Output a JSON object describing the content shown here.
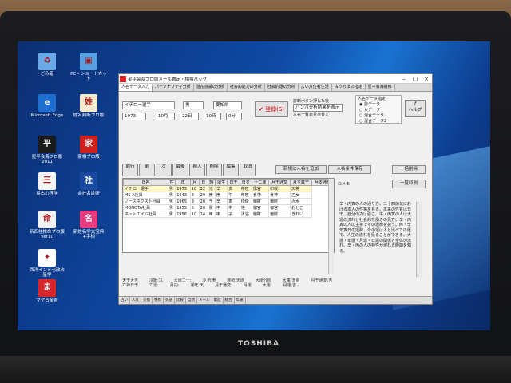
{
  "laptop": {
    "brand": "TOSHIBA"
  },
  "desktop_icons": [
    {
      "label": "ごみ箱",
      "icon": "recycle-bin-icon",
      "color": "#6aa8e8",
      "glyph": "♻"
    },
    {
      "label": "PC - ショートカット",
      "icon": "pc-icon",
      "color": "#5a9fe0",
      "glyph": "▣"
    },
    {
      "label": "Microsoft Edge",
      "icon": "edge-icon",
      "color": "#1f6fd0",
      "glyph": "e"
    },
    {
      "label": "姓名判断プロ版",
      "icon": "seimei-icon",
      "color": "#f5e9d0",
      "glyph": "姓"
    },
    {
      "label": "星平会海プロ版 2011",
      "icon": "hoshi-icon",
      "color": "#1a1a1a",
      "glyph": "平"
    },
    {
      "label": "家相プロ版",
      "icon": "kaso-icon",
      "color": "#d0201b",
      "glyph": "家"
    },
    {
      "label": "易占心理学",
      "icon": "ekisen-icon",
      "color": "#f4f4f4",
      "glyph": "三"
    },
    {
      "label": "会社名診断",
      "icon": "company-icon",
      "color": "#1a4aa0",
      "glyph": "社"
    },
    {
      "label": "新四柱推命プロ版 Ver10",
      "icon": "shichu-icon",
      "color": "#f2f2f2",
      "glyph": "命"
    },
    {
      "label": "新姓名学大宝典+手相",
      "icon": "tesou-icon",
      "color": "#e83a7e",
      "glyph": "名"
    },
    {
      "label": "西洋インド七政占星学",
      "icon": "seiyo-icon",
      "color": "#ffffff",
      "glyph": "✦"
    },
    {
      "label": "マヤ占星術",
      "icon": "maya-icon",
      "color": "#d6262c",
      "glyph": "ま"
    }
  ],
  "window": {
    "title": "星平会海プロ版メール鑑定・相場パック",
    "tabs": [
      "人名データ入力",
      "パーソナリティ分析",
      "潜在意識の分析",
      "社会的能力の分析",
      "社会的運の分析",
      "よい方位者生活",
      "占う方法の指定",
      "星平会海雑料"
    ],
    "active_tab": 0,
    "name_value": "イチロー選手",
    "sex_value": "男",
    "pref_value": "愛知県",
    "year_value": "1973",
    "month_value": "10月",
    "day_value": "22日",
    "hour_value": "10時",
    "min_value": "0分",
    "register_label": "登録(S)",
    "display_label": "診断ボタン押した後",
    "display_value": "パンパ分析結果を表示",
    "list_label": "人名一覧表並び替え",
    "radio_title": "人名データ指定",
    "radios": [
      "男データ",
      "女データ",
      "混合データ",
      "混合データ2"
    ],
    "help_label": "ヘルプ",
    "nav_buttons": [
      "前行",
      "前",
      "次",
      "最後",
      "挿入",
      "削除",
      "編集",
      "取消"
    ],
    "new_label": "新規に人名を追加",
    "save_label": "人名条件保存",
    "all_clear_label": "一括削除",
    "all_print_label": "一覧印刷",
    "memo_label": "ロメモ",
    "columns": [
      "氏名",
      "性",
      "年",
      "月",
      "日",
      "時",
      "誕生",
      "日干",
      "日支",
      "十二運",
      "月干通変",
      "月支蔵干",
      "月支通変"
    ],
    "rows": [
      [
        "イチロー選手",
        "男",
        "1973",
        "10",
        "22",
        "光",
        "辛",
        "亥",
        "帝旺",
        "傷官",
        "印綬",
        "天将"
      ],
      [
        "MS A社員",
        "男",
        "1943",
        "8",
        "29",
        "庚",
        "庚",
        "午",
        "帝旺",
        "食神",
        "食神",
        "乙女"
      ],
      [
        "ノースネクスト社員",
        "男",
        "1965",
        "9",
        "28",
        "壬",
        "辛",
        "寅",
        "印綬",
        "偏財",
        "偏財",
        "沢水"
      ],
      [
        "MONOTA社員",
        "男",
        "1955",
        "6",
        "28",
        "癸",
        "甲",
        "申",
        "絶",
        "偏官",
        "偏官",
        "おとこ"
      ],
      [
        "ネットエイジ社員",
        "男",
        "1956",
        "10",
        "24",
        "甲",
        "甲",
        "子",
        "沐浴",
        "偏財",
        "偏財",
        "きれい"
      ]
    ],
    "result_text": "辛・丙寅の人の通り方。二十四節気における本人の性格を見る。本来の性質は日干、自分の力は強さ。午・丙寅の人は大運の流れと社会的な働きの見方。辛・丙寅の人の主導でその運命を扱う。丙・辛年寅日の運勢、今の運は人と比べての運で、人生の流れを見ることができる。大運・年運・月運・日運の関係と全体の流れ。辛・丙の人の特性が現れる時期を知る。",
    "status_lines": [
      [
        "天干大吉",
        "冷暖:丸",
        "大運二十:",
        "冷:光庚",
        "運勢:天道",
        "大運分析",
        "大庫:天貴",
        "月干通変:吉"
      ],
      [
        "亡神日干",
        "亡運:",
        "月内:",
        "運旺:天",
        "月干通変:",
        "月運",
        "大運:",
        "月運:吉"
      ]
    ],
    "bottom_tabs": [
      "占い",
      "人気",
      "交換",
      "特殊",
      "英語",
      "比較",
      "自然",
      "メール",
      "電話",
      "総合",
      "年運"
    ]
  }
}
